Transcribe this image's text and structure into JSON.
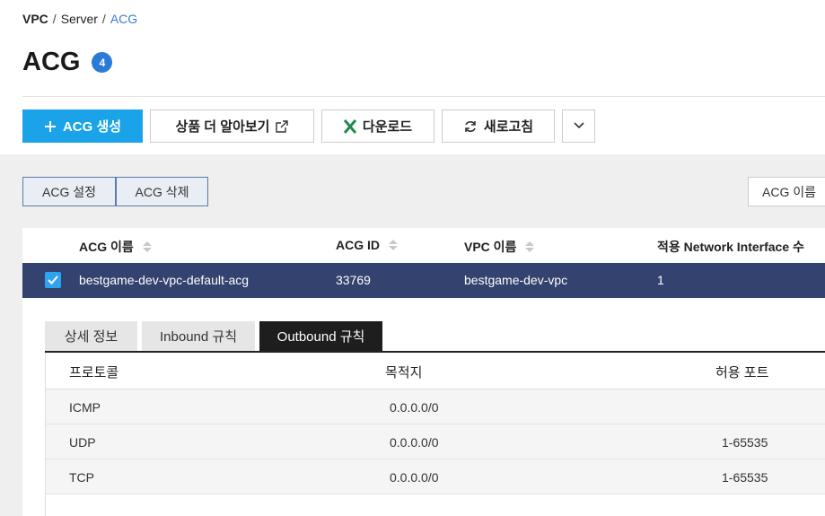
{
  "breadcrumb": [
    {
      "label": "VPC",
      "sep": "/"
    },
    {
      "label": "Server",
      "sep": "/"
    },
    {
      "label": "ACG",
      "sep": ""
    }
  ],
  "page": {
    "title": "ACG",
    "count": "4"
  },
  "toolbar": {
    "create_label": "ACG 생성",
    "learn_more_label": "상품 더 알아보기",
    "download_label": "다운로드",
    "refresh_label": "새로고침"
  },
  "sub_toolbar": {
    "settings_label": "ACG 설정",
    "delete_label": "ACG 삭제",
    "filter_label": "ACG 이름"
  },
  "table": {
    "columns": [
      "ACG 이름",
      "ACG ID",
      "VPC 이름",
      "적용 Network Interface 수"
    ],
    "selected_row": {
      "name": "bestgame-dev-vpc-default-acg",
      "id": "33769",
      "vpc": "bestgame-dev-vpc",
      "interfaces": "1",
      "checked": true
    }
  },
  "detail_tabs": [
    "상세 정보",
    "Inbound 규칙",
    "Outbound 규칙"
  ],
  "active_tab": "Outbound 규칙",
  "rules": {
    "columns": [
      "프로토콜",
      "목적지",
      "허용 포트"
    ],
    "rows": [
      {
        "protocol": "ICMP",
        "destination": "0.0.0.0/0",
        "port": ""
      },
      {
        "protocol": "UDP",
        "destination": "0.0.0.0/0",
        "port": "1-65535"
      },
      {
        "protocol": "TCP",
        "destination": "0.0.0.0/0",
        "port": "1-65535"
      }
    ]
  },
  "colors": {
    "primary": "#1aa3e8",
    "badge": "#2a7bd8",
    "selected_row": "#33426e",
    "excel_green": "#1e8a4c"
  },
  "icons": [
    "plus-icon",
    "external-link-icon",
    "excel-icon",
    "refresh-icon",
    "chevron-down-icon",
    "sort-icon",
    "check-icon"
  ]
}
